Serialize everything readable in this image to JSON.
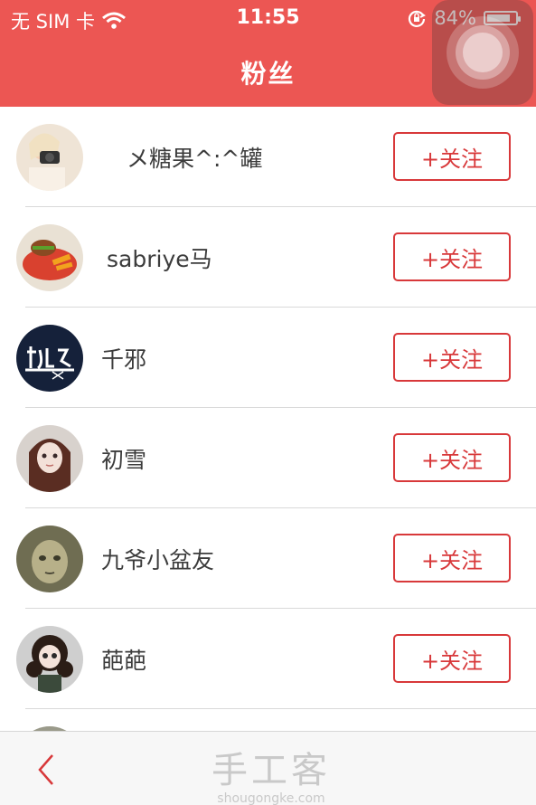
{
  "status_bar": {
    "carrier": "无 SIM 卡",
    "time": "11:55",
    "battery": "84%",
    "battery_level": 0.84
  },
  "header": {
    "title": "粉丝"
  },
  "followers": [
    {
      "name": "メ糖果^:^罐",
      "button": "+关注",
      "avatar": "girl-camera"
    },
    {
      "name": "sabriye马",
      "button": "+关注",
      "avatar": "food"
    },
    {
      "name": "千邪",
      "button": "+关注",
      "avatar": "calligraphy-logo"
    },
    {
      "name": "初雪",
      "button": "+关注",
      "avatar": "doll"
    },
    {
      "name": "九爷小盆友",
      "button": "+关注",
      "avatar": "ghost-face"
    },
    {
      "name": "葩葩",
      "button": "+关注",
      "avatar": "doll-curls"
    }
  ],
  "footer": {
    "watermark_cn": "手工客",
    "watermark_en": "shougongke.com"
  },
  "colors": {
    "header_bg": "#ec5653",
    "accent": "#d8383a",
    "text": "#3c3c3c",
    "separator": "#d9d9d9"
  }
}
